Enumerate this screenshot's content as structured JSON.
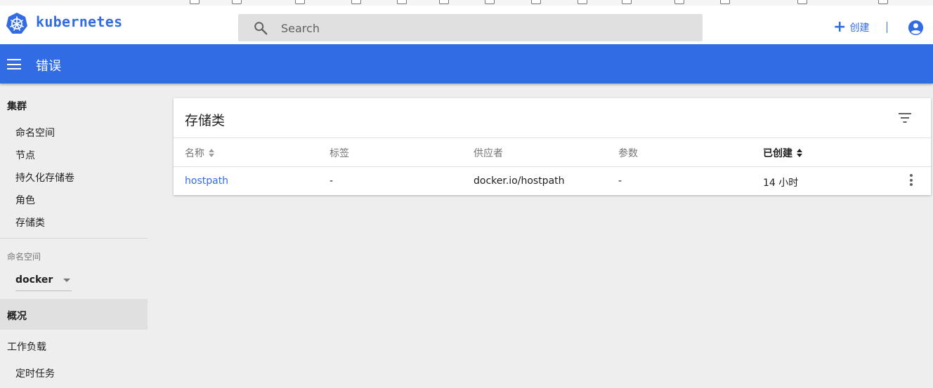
{
  "brand": {
    "name": "kubernetes",
    "color": "#326ce5"
  },
  "search": {
    "placeholder": "Search"
  },
  "header": {
    "create_label": "创建"
  },
  "appbar": {
    "title": "错误"
  },
  "sidebar": {
    "cluster_section": "集群",
    "cluster_items": [
      "命名空间",
      "节点",
      "持久化存储卷",
      "角色",
      "存储类"
    ],
    "namespace_label": "命名空间",
    "namespace_value": "docker",
    "overview": "概况",
    "workloads_section": "工作负载",
    "workload_items": [
      "定时任务"
    ]
  },
  "card": {
    "title": "存储类",
    "columns": [
      "名称",
      "标签",
      "供应者",
      "参数",
      "已创建"
    ],
    "rows": [
      {
        "name": "hostpath",
        "labels": "-",
        "provisioner": "docker.io/hostpath",
        "parameters": "-",
        "created": "14 小时"
      }
    ]
  },
  "icons": {
    "logo": "kubernetes-wheel-icon",
    "search": "search-icon",
    "create": "plus-icon",
    "account": "account-circle-icon",
    "menu": "hamburger-menu-icon",
    "filter": "filter-list-icon",
    "more": "more-vert-icon",
    "sort": "sort-arrows-icon",
    "dropdown": "arrow-drop-down-icon"
  }
}
